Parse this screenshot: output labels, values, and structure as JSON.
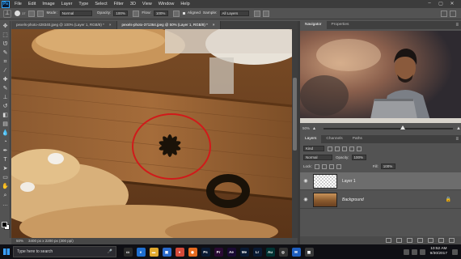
{
  "app": {
    "logo": "Ps"
  },
  "menu": [
    "File",
    "Edit",
    "Image",
    "Layer",
    "Type",
    "Select",
    "Filter",
    "3D",
    "View",
    "Window",
    "Help"
  ],
  "options": {
    "brush_size": "17",
    "mode_label": "Mode:",
    "mode_value": "Normal",
    "opacity_label": "Opacity:",
    "opacity_value": "100%",
    "flow_label": "Flow:",
    "flow_value": "100%",
    "aligned_label": "Aligned",
    "sample_label": "Sample:",
    "sample_value": "All Layers"
  },
  "tabs": [
    {
      "label": "pexels-photo-428340.jpeg @ 100% (Layer 1, RGB/8) *",
      "close": "×"
    },
    {
      "label": "pexels-photo-371364.jpeg @ 50% (Layer 1, RGB/8) *",
      "close": "×"
    }
  ],
  "status": {
    "zoom": "50%",
    "doc": "3400 px x 2200 px (300 ppi)"
  },
  "navigator": {
    "tabs": [
      "Navigator",
      "Properties"
    ],
    "zoom": "50%"
  },
  "layers": {
    "tabs": [
      "Layers",
      "Channels",
      "Paths"
    ],
    "kind": "Kind",
    "blend": "Normal",
    "opacity_label": "Opacity:",
    "opacity_value": "100%",
    "lock_label": "Lock:",
    "fill_label": "Fill:",
    "fill_value": "100%",
    "items": [
      {
        "name": "Layer 1",
        "selected": true
      },
      {
        "name": "Background",
        "selected": false
      }
    ]
  },
  "taskbar": {
    "search_placeholder": "Type here to search",
    "apps": [
      {
        "name": "task-view",
        "label": "▭",
        "color": "#2a2a2a"
      },
      {
        "name": "edge",
        "label": "e",
        "color": "#1f6fd0"
      },
      {
        "name": "file-explorer",
        "label": "▬",
        "color": "#e0a82e"
      },
      {
        "name": "store",
        "label": "▣",
        "color": "#2a6acb"
      },
      {
        "name": "chrome",
        "label": "●",
        "color": "#d44a3a"
      },
      {
        "name": "firefox",
        "label": "◉",
        "color": "#e66b1f"
      },
      {
        "name": "photoshop",
        "label": "Ps",
        "color": "#0a1a33"
      },
      {
        "name": "premiere",
        "label": "Pr",
        "color": "#2a0a33"
      },
      {
        "name": "after-effects",
        "label": "Ae",
        "color": "#1a0a33"
      },
      {
        "name": "media-encoder",
        "label": "Me",
        "color": "#0a1a33"
      },
      {
        "name": "lightroom",
        "label": "Lr",
        "color": "#0a1a33"
      },
      {
        "name": "audition",
        "label": "Au",
        "color": "#003333"
      },
      {
        "name": "obs",
        "label": "◎",
        "color": "#333"
      },
      {
        "name": "mail",
        "label": "✉",
        "color": "#1f5fbf"
      },
      {
        "name": "calculator",
        "label": "▦",
        "color": "#3a3a3a"
      }
    ],
    "time": "10:52 AM",
    "date": "9/30/2017"
  }
}
